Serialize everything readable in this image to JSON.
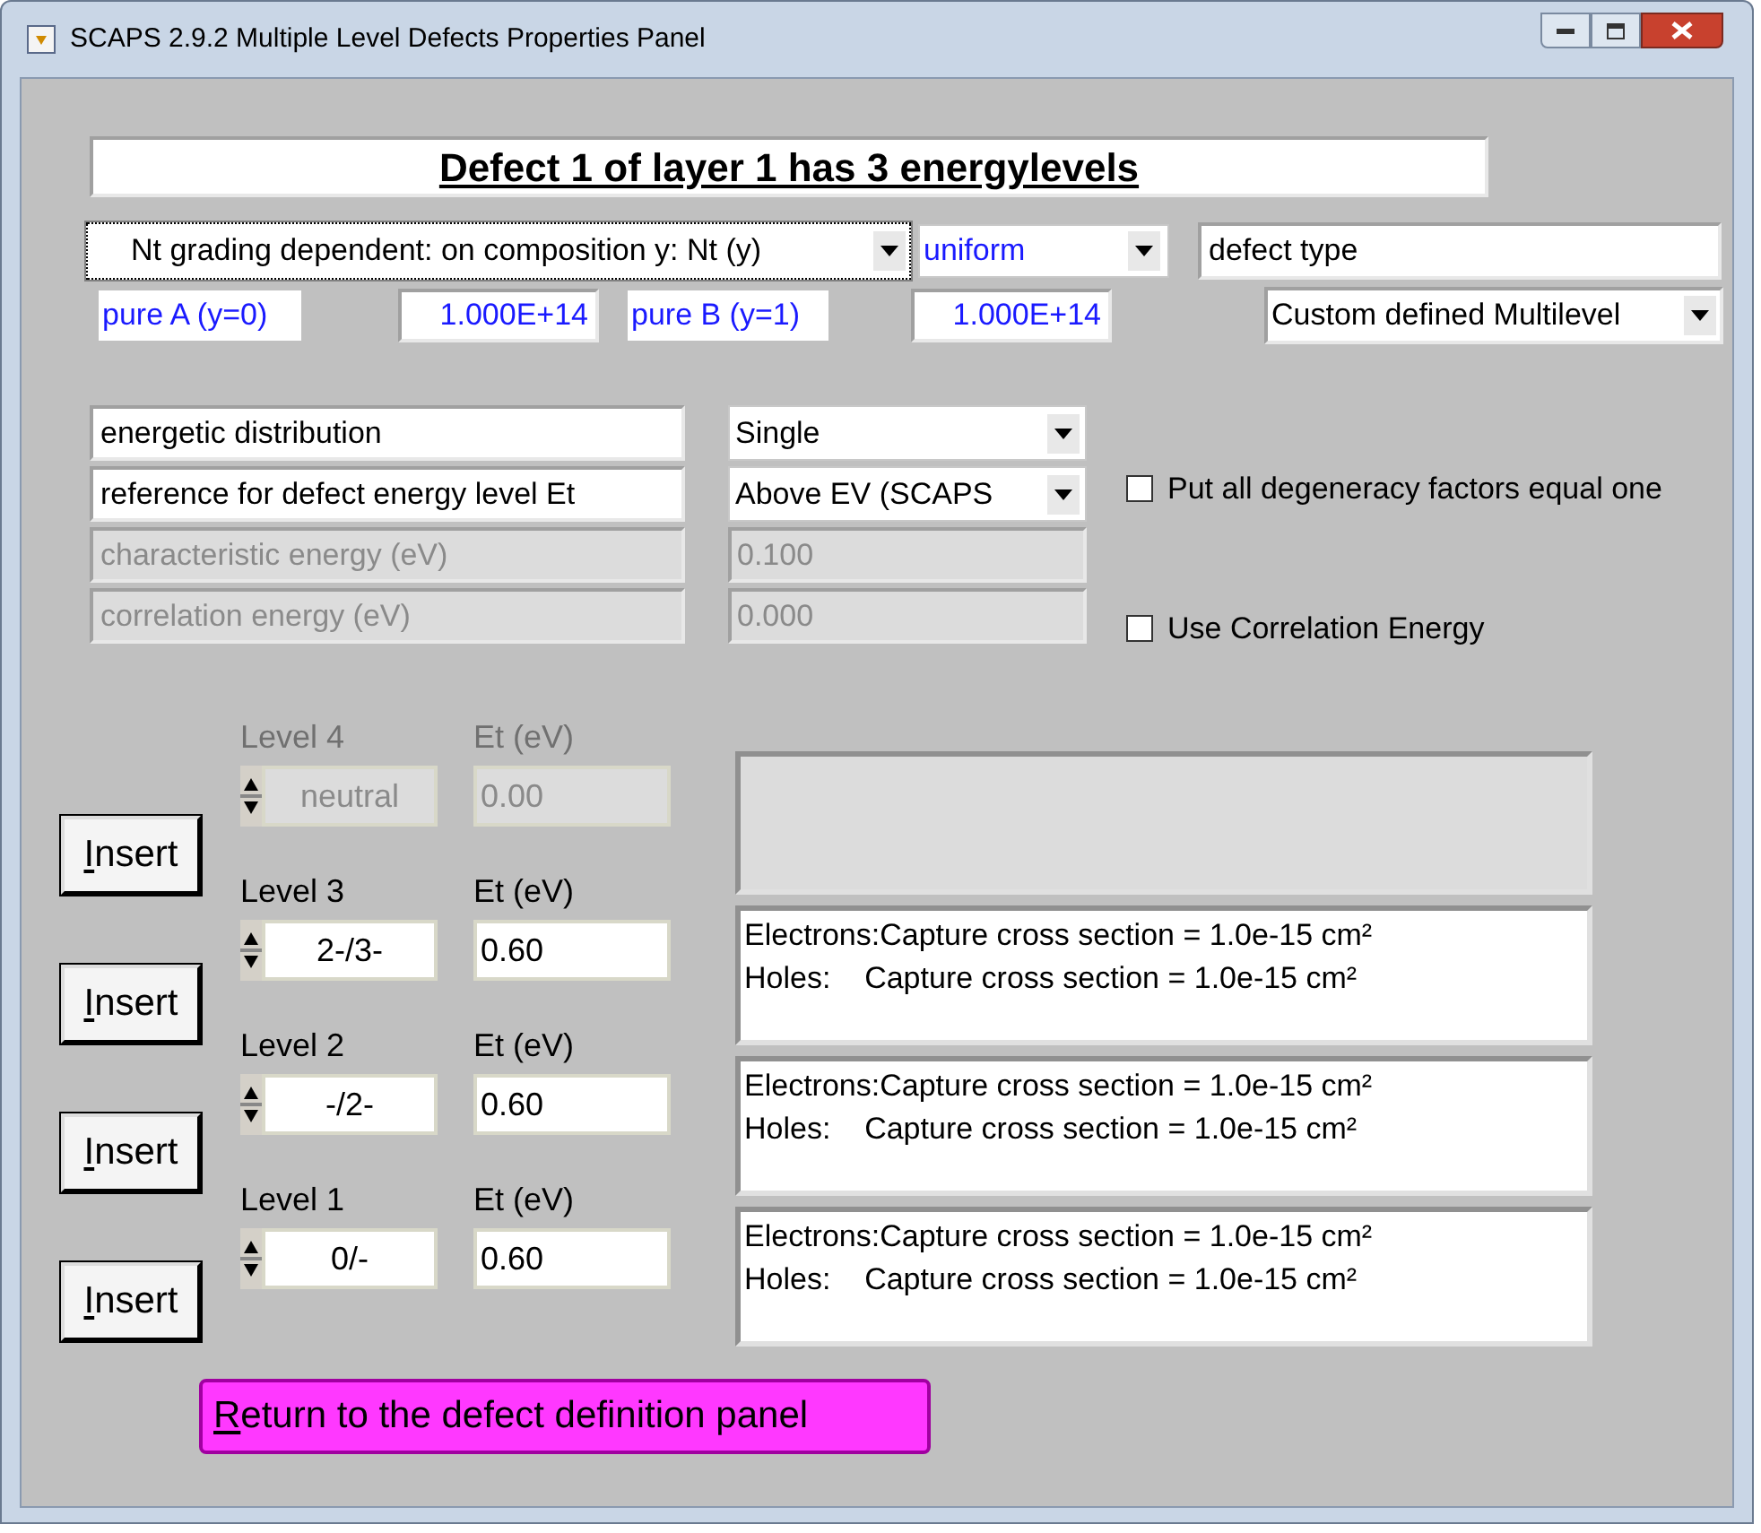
{
  "window": {
    "title": "SCAPS 2.9.2 Multiple Level Defects Properties Panel"
  },
  "heading": "Defect 1 of layer 1 has 3 energylevels",
  "grading": {
    "mode": "Nt grading dependent: on composition y: Nt (y)",
    "profile": "uniform",
    "pure_a_label": "pure A (y=0)",
    "pure_a_value": "1.000E+14",
    "pure_b_label": "pure B (y=1)",
    "pure_b_value": "1.000E+14"
  },
  "defect_type": {
    "label": "defect type",
    "value": "Custom defined Multilevel"
  },
  "properties": [
    {
      "label": "energetic distribution",
      "value": "Single",
      "kind": "dropdown",
      "disabled": false
    },
    {
      "label": "reference for defect energy level Et",
      "value": "Above EV (SCAPS",
      "kind": "dropdown",
      "disabled": false
    },
    {
      "label": "characteristic energy (eV)",
      "value": "0.100",
      "kind": "field",
      "disabled": true
    },
    {
      "label": "correlation energy (eV)",
      "value": "0.000",
      "kind": "field",
      "disabled": true
    }
  ],
  "checkboxes": [
    {
      "label": "Put all degeneracy factors equal one",
      "checked": false
    },
    {
      "label": "Use Correlation Energy",
      "checked": false
    }
  ],
  "levels": [
    {
      "label": "Level 4",
      "charge": "neutral",
      "et_label": "Et (eV)",
      "et": "0.00",
      "disabled": true
    },
    {
      "label": "Level 3",
      "charge": "2-/3-",
      "et_label": "Et (eV)",
      "et": "0.60",
      "disabled": false,
      "cross_sections": [
        "Electrons:Capture cross section = 1.0e-15 cm²",
        "Holes:    Capture cross section = 1.0e-15 cm²"
      ]
    },
    {
      "label": "Level 2",
      "charge": "-/2-",
      "et_label": "Et (eV)",
      "et": "0.60",
      "disabled": false,
      "cross_sections": [
        "Electrons:Capture cross section = 1.0e-15 cm²",
        "Holes:    Capture cross section = 1.0e-15 cm²"
      ]
    },
    {
      "label": "Level 1",
      "charge": "0/-",
      "et_label": "Et (eV)",
      "et": "0.60",
      "disabled": false,
      "cross_sections": [
        "Electrons:Capture cross section = 1.0e-15 cm²",
        "Holes:    Capture cross section = 1.0e-15 cm²"
      ]
    }
  ],
  "insert_buttons": [
    "Insert",
    "Insert",
    "Insert",
    "Insert"
  ],
  "return_button": "Return to the defect definition panel"
}
